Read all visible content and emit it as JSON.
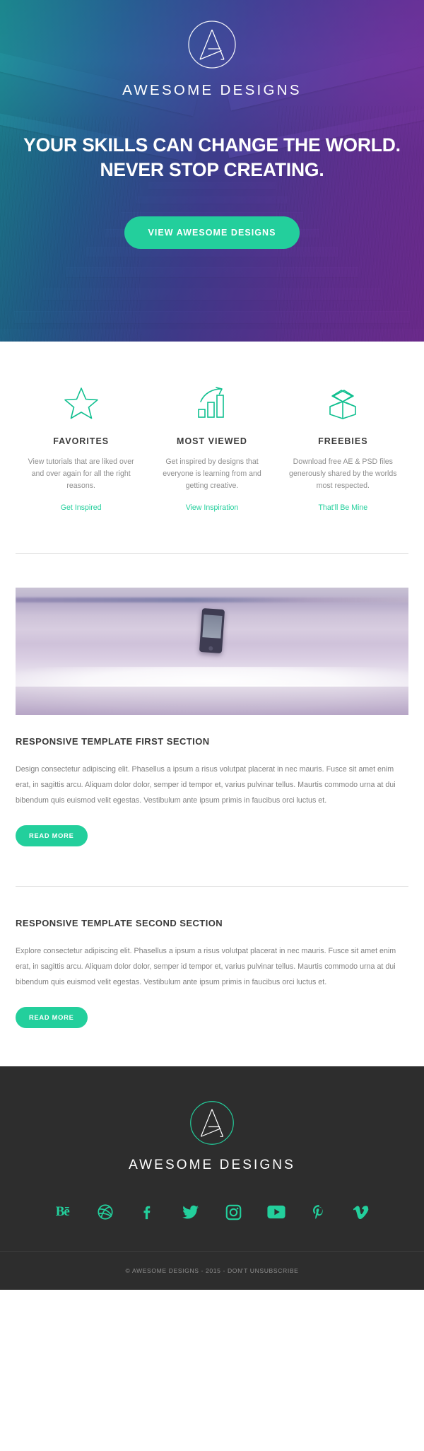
{
  "colors": {
    "accent": "#23cf9c",
    "hero_gradient_start": "#17a4a6",
    "hero_gradient_mid": "#4e46af",
    "hero_gradient_end": "#8a30ac",
    "footer_bg": "#2d2d2d",
    "heading": "#3a3a3a",
    "body_text": "#808080",
    "muted_text": "#8e8e8e"
  },
  "hero": {
    "logo_icon": "awesome-designs-a-logo",
    "brand": "AWESOME DESIGNS",
    "headline_line1": "YOUR SKILLS CAN CHANGE THE WORLD.",
    "headline_line2": "NEVER STOP CREATING.",
    "cta_label": "VIEW AWESOME DESIGNS"
  },
  "features": [
    {
      "icon": "star-icon",
      "title": "FAVORITES",
      "body": "View tutorials that are liked over and over again for all the right reasons.",
      "link": "Get Inspired"
    },
    {
      "icon": "bar-chart-growth-icon",
      "title": "MOST VIEWED",
      "body": "Get inspired by designs that everyone is learning from and getting creative.",
      "link": "View Inspiration"
    },
    {
      "icon": "open-box-icon",
      "title": "FREEBIES",
      "body": "Download free AE & PSD files generously shared by the worlds most respected.",
      "link": "That'll Be Mine"
    }
  ],
  "sections": [
    {
      "image": "phone-in-beach-surf-photo",
      "title": "RESPONSIVE TEMPLATE FIRST SECTION",
      "body": "Design consectetur adipiscing elit. Phasellus a ipsum a risus volutpat placerat in nec mauris. Fusce sit amet enim erat, in sagittis arcu. Aliquam dolor dolor, semper id tempor et, varius pulvinar tellus. Maurtis commodo urna at dui bibendum quis euismod velit egestas. Vestibulum ante ipsum primis in faucibus orci luctus et.",
      "button": "READ MORE"
    },
    {
      "title": "RESPONSIVE TEMPLATE SECOND SECTION",
      "body": "Explore consectetur adipiscing elit. Phasellus a ipsum a risus volutpat placerat in nec mauris. Fusce sit amet enim erat, in sagittis arcu. Aliquam dolor dolor, semper id tempor et, varius pulvinar tellus. Maurtis commodo urna at dui bibendum quis euismod velit egestas. Vestibulum ante ipsum primis in faucibus orci luctus et.",
      "button": "READ MORE"
    }
  ],
  "footer": {
    "logo_icon": "awesome-designs-a-logo",
    "brand": "AWESOME DESIGNS",
    "social": [
      {
        "name": "behance-icon",
        "label": "Bē"
      },
      {
        "name": "dribbble-icon",
        "label": ""
      },
      {
        "name": "facebook-icon",
        "label": ""
      },
      {
        "name": "twitter-icon",
        "label": ""
      },
      {
        "name": "instagram-icon",
        "label": ""
      },
      {
        "name": "youtube-icon",
        "label": ""
      },
      {
        "name": "pinterest-icon",
        "label": ""
      },
      {
        "name": "vimeo-icon",
        "label": ""
      }
    ],
    "copyright": "© AWESOME DESIGNS - 2015 - DON'T UNSUBSCRIBE"
  }
}
